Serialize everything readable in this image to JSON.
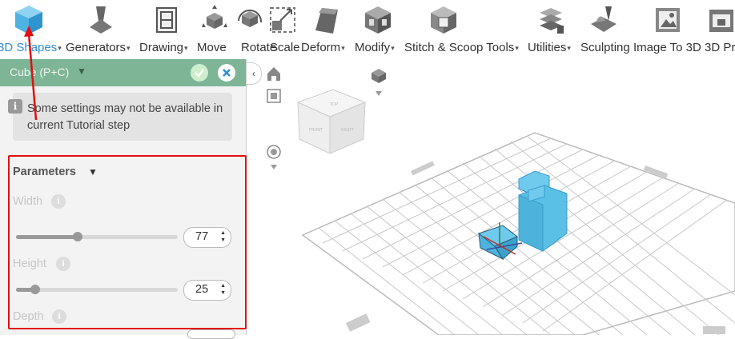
{
  "toolbar": {
    "tools": [
      {
        "id": "3d-shapes",
        "label": "3D Shapes",
        "caret": true,
        "active": true
      },
      {
        "id": "generators",
        "label": "Generators",
        "caret": true
      },
      {
        "id": "drawing",
        "label": "Drawing",
        "caret": true
      },
      {
        "id": "move",
        "label": "Move",
        "caret": false
      },
      {
        "id": "rotate",
        "label": "Rotate",
        "caret": false
      },
      {
        "id": "scale",
        "label": "Scale",
        "caret": false
      },
      {
        "id": "deform",
        "label": "Deform",
        "caret": true
      },
      {
        "id": "modify",
        "label": "Modify",
        "caret": true
      },
      {
        "id": "stitch-scoop",
        "label": "Stitch & Scoop Tools",
        "caret": true
      },
      {
        "id": "utilities",
        "label": "Utilities",
        "caret": true
      },
      {
        "id": "sculpting",
        "label": "Sculpting",
        "caret": false
      },
      {
        "id": "image-to-3d",
        "label": "Image To 3D",
        "caret": false
      },
      {
        "id": "3d-print",
        "label": "3D Pr",
        "caret": false
      }
    ],
    "caret_glyph": "▾"
  },
  "panel": {
    "title": "Cube (P+C)",
    "info_glyph": "i",
    "info_text": "Some settings may not be available in current Tutorial step",
    "parameters_title": "Parameters",
    "fields": {
      "width": {
        "label": "Width",
        "value": "77",
        "level": 0.38
      },
      "height": {
        "label": "Height",
        "value": "25",
        "level": 0.12
      },
      "depth": {
        "label": "Depth"
      }
    }
  },
  "viewport": {
    "collapse_glyph": "‹"
  },
  "colors": {
    "accent_blue": "#2f8fd8",
    "panel_header": "#7db596",
    "highlight_red": "#e01010",
    "shape_fill": "#5bc0e6"
  }
}
